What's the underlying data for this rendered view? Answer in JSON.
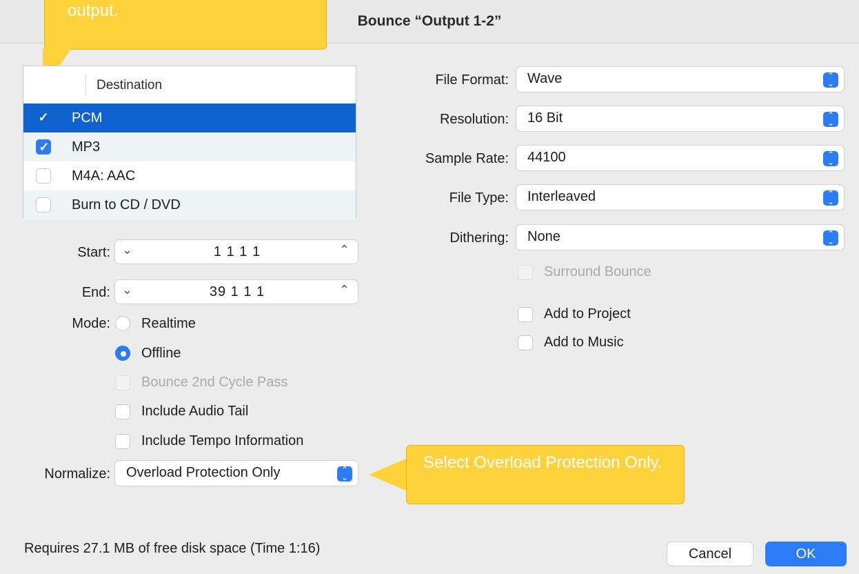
{
  "window": {
    "title": "Bounce “Output 1-2”"
  },
  "callouts": {
    "top": "output.",
    "bottom": "Select Overload Protection Only."
  },
  "destination": {
    "header": "Destination",
    "rows": [
      {
        "label": "PCM",
        "checked": true,
        "selected": true
      },
      {
        "label": "MP3",
        "checked": true,
        "selected": false
      },
      {
        "label": "M4A: AAC",
        "checked": false,
        "selected": false
      },
      {
        "label": "Burn to CD / DVD",
        "checked": false,
        "selected": false
      }
    ]
  },
  "range": {
    "start_label": "Start:",
    "start_value": "1 1 1     1",
    "end_label": "End:",
    "end_value": "39 1 1     1"
  },
  "mode": {
    "label": "Mode:",
    "options": [
      {
        "label": "Realtime",
        "selected": false
      },
      {
        "label": "Offline",
        "selected": true
      }
    ]
  },
  "options": {
    "bounce_2nd_cycle": "Bounce 2nd Cycle Pass",
    "include_audio_tail": "Include Audio Tail",
    "include_tempo": "Include Tempo Information"
  },
  "normalize": {
    "label": "Normalize:",
    "value": "Overload Protection Only"
  },
  "format": {
    "file_format_label": "File Format:",
    "file_format_value": "Wave",
    "resolution_label": "Resolution:",
    "resolution_value": "16 Bit",
    "sample_rate_label": "Sample Rate:",
    "sample_rate_value": "44100",
    "file_type_label": "File Type:",
    "file_type_value": "Interleaved",
    "dithering_label": "Dithering:",
    "dithering_value": "None",
    "surround_bounce": "Surround Bounce",
    "add_to_project": "Add to Project",
    "add_to_music": "Add to Music"
  },
  "footer": {
    "disk_space": "Requires 27.1 MB of free disk space  (Time 1:16)",
    "cancel": "Cancel",
    "ok": "OK"
  },
  "colors": {
    "accent": "#2b7cf6",
    "selection": "#0f63cf",
    "callout": "#fdd23b"
  }
}
